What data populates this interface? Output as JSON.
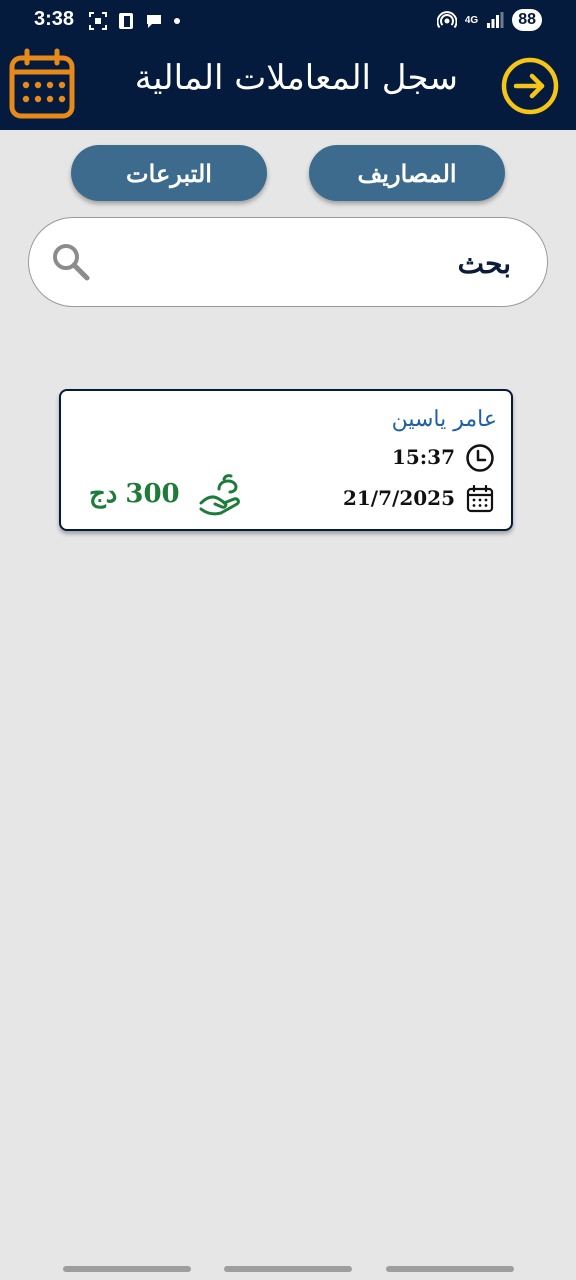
{
  "status_bar": {
    "time": "3:38",
    "battery": "88",
    "network": "4G"
  },
  "app_bar": {
    "title": "سجل المعاملات المالية",
    "back_icon": "arrow-right-circle-icon",
    "calendar_icon": "calendar-icon"
  },
  "tabs": [
    {
      "label": "المصاريف"
    },
    {
      "label": "التبرعات"
    }
  ],
  "search": {
    "placeholder": "بحث",
    "value": ""
  },
  "transactions": [
    {
      "name": "عامر ياسين",
      "time": "15:37",
      "date": "21/7/2025",
      "amount": "300",
      "currency": "دج"
    }
  ],
  "colors": {
    "header_bg": "#051b3d",
    "tab_bg": "#3d6b8e",
    "accent_orange": "#e88a1a",
    "accent_yellow": "#f5c518",
    "amount_green": "#1e7b3a",
    "name_blue": "#1f5fa6"
  }
}
